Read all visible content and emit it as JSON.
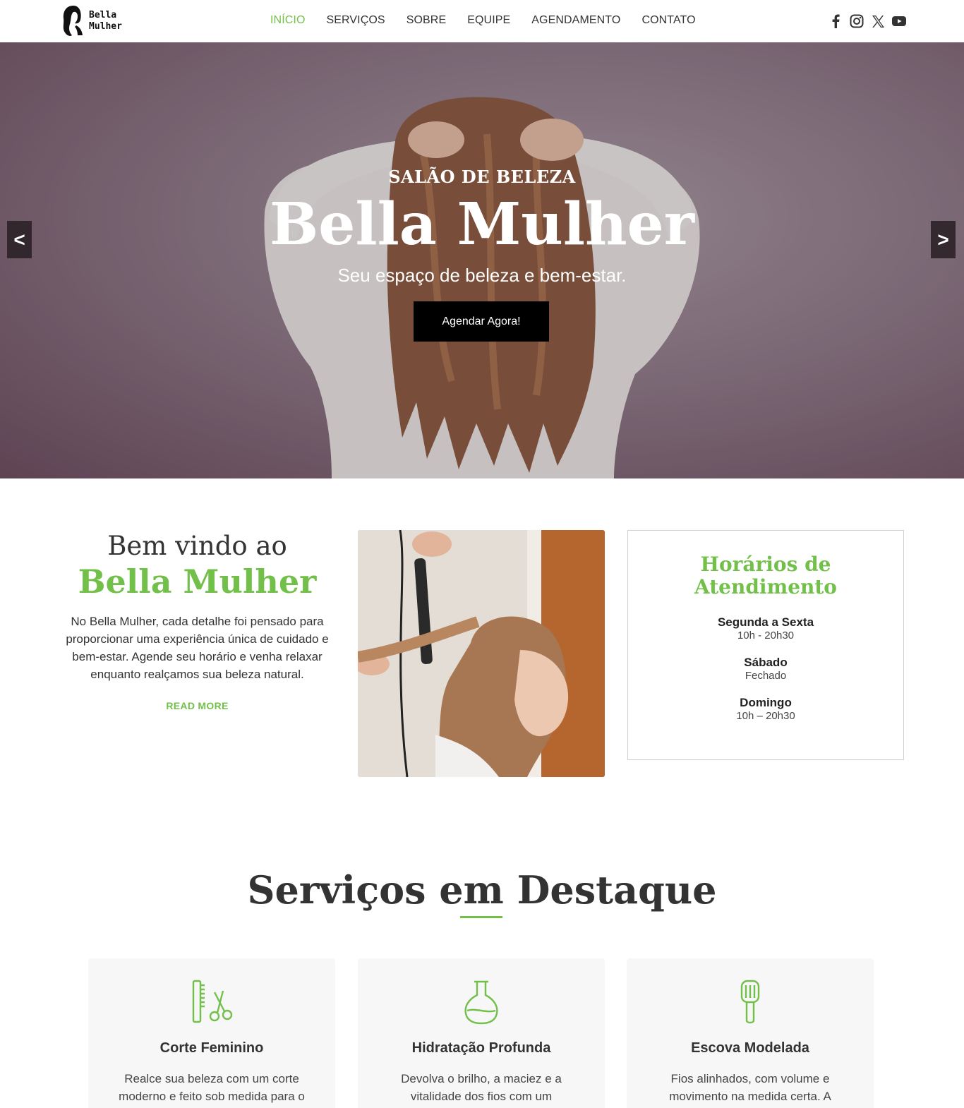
{
  "header": {
    "logo_line1": "Bella",
    "logo_line2": "Mulher",
    "nav": [
      "INÍCIO",
      "SERVIÇOS",
      "SOBRE",
      "EQUIPE",
      "AGENDAMENTO",
      "CONTATO"
    ],
    "active_nav": "INÍCIO",
    "social_icons": [
      "facebook-icon",
      "instagram-icon",
      "x-icon",
      "youtube-icon"
    ]
  },
  "hero": {
    "kicker": "SALÃO DE BELEZA",
    "title": "Bella Mulher",
    "subtitle": "Seu espaço de beleza e bem-estar.",
    "cta": "Agendar Agora!",
    "prev": "<",
    "next": ">"
  },
  "welcome": {
    "pre": "Bem vindo ao",
    "brand": "Bella Mulher",
    "text": "No Bella Mulher, cada detalhe foi pensado para proporcionar uma experiência única de cuidado e bem-estar. Agende seu horário e venha relaxar enquanto realçamos sua beleza natural.",
    "read_more": "READ MORE"
  },
  "hours": {
    "title": "Horários de Atendimento",
    "items": [
      {
        "day": "Segunda a Sexta",
        "time": "10h - 20h30"
      },
      {
        "day": "Sábado",
        "time": "Fechado"
      },
      {
        "day": "Domingo",
        "time": "10h – 20h30"
      }
    ]
  },
  "services": {
    "title": "Serviços em Destaque",
    "cards": [
      {
        "icon": "comb-scissors-icon",
        "title": "Corte Feminino",
        "text": "Realce sua beleza com um corte moderno e feito sob medida para o"
      },
      {
        "icon": "flask-icon",
        "title": "Hidratação Profunda",
        "text": "Devolva o brilho, a maciez e a vitalidade dos fios com um"
      },
      {
        "icon": "hairbrush-icon",
        "title": "Escova Modelada",
        "text": "Fios alinhados, com volume e movimento na medida certa. A"
      }
    ]
  },
  "colors": {
    "accent": "#72c04a",
    "text": "#333333",
    "button": "#000000"
  }
}
